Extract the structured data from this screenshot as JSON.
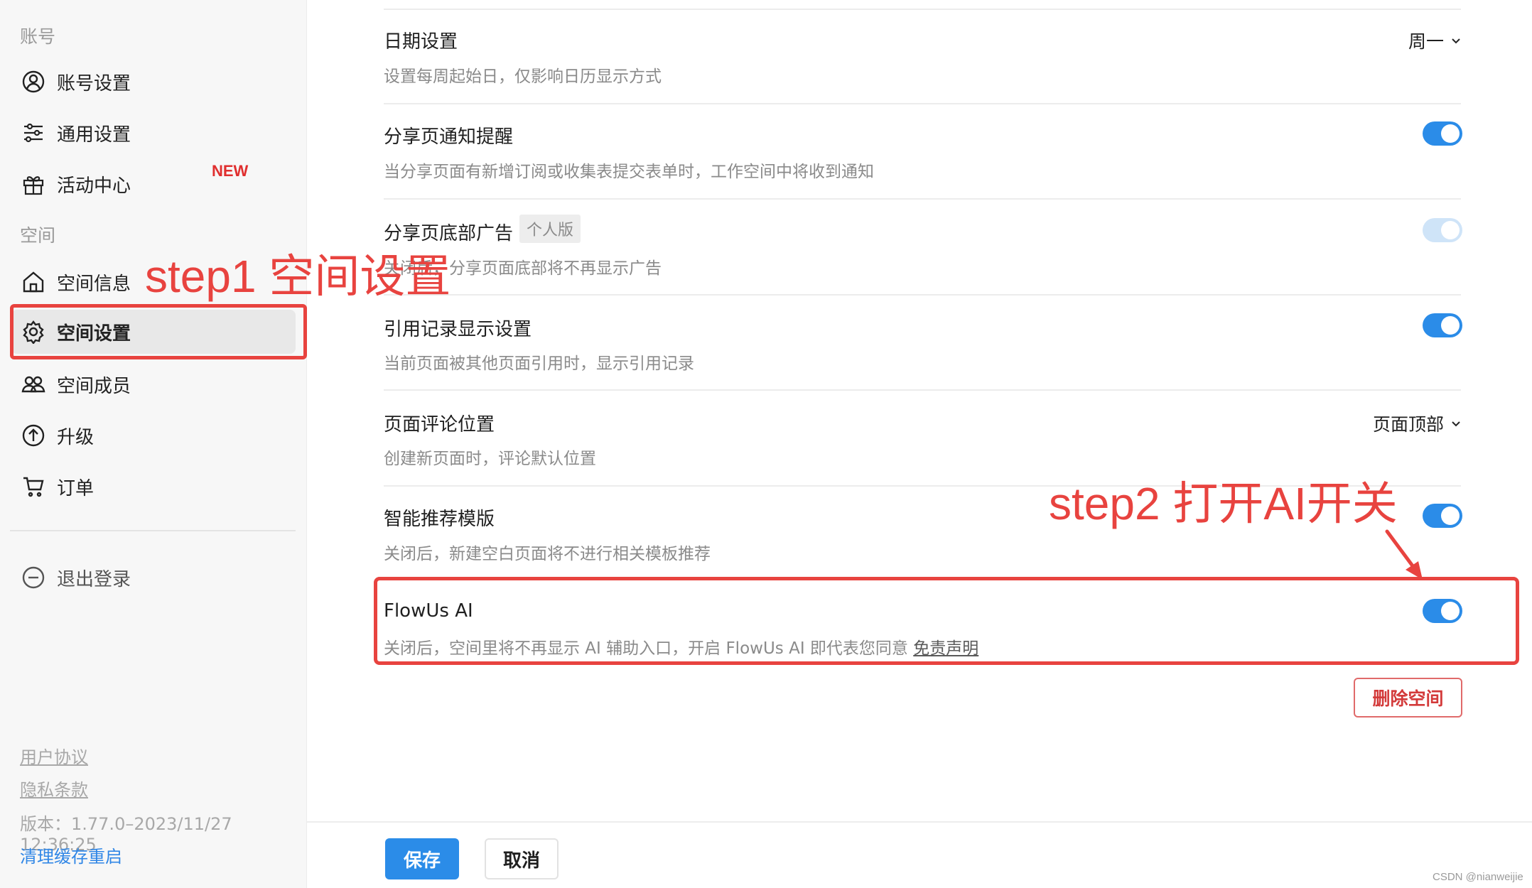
{
  "sidebar": {
    "account_section": "账号",
    "account_items": [
      {
        "label": "账号设置",
        "icon": "user-circle-icon"
      },
      {
        "label": "通用设置",
        "icon": "sliders-icon"
      },
      {
        "label": "活动中心",
        "icon": "gift-icon",
        "badge": "NEW"
      }
    ],
    "space_section": "空间",
    "space_items": [
      {
        "label": "空间信息",
        "icon": "home-icon"
      },
      {
        "label": "空间设置",
        "icon": "gear-icon",
        "active": true
      },
      {
        "label": "空间成员",
        "icon": "members-icon"
      },
      {
        "label": "升级",
        "icon": "arrow-up-circle-icon"
      },
      {
        "label": "订单",
        "icon": "cart-icon"
      }
    ],
    "logout": "退出登录",
    "user_agreement": "用户协议",
    "privacy_policy": "隐私条款",
    "version": "版本：1.77.0–2023/11/27 12:36:25",
    "clear_cache": "清理缓存重启"
  },
  "settings": [
    {
      "title": "日期设置",
      "desc": "设置每周起始日，仅影响日历显示方式",
      "control": "dropdown",
      "value": "周一"
    },
    {
      "title": "分享页通知提醒",
      "desc": "当分享页面有新增订阅或收集表提交表单时，工作空间中将收到通知",
      "control": "toggle",
      "on": true
    },
    {
      "title": "分享页底部广告",
      "badge": "个人版",
      "desc": "关闭后，分享页面底部将不再显示广告",
      "control": "toggle",
      "on": true,
      "disabled": true
    },
    {
      "title": "引用记录显示设置",
      "desc": "当前页面被其他页面引用时，显示引用记录",
      "control": "toggle",
      "on": true
    },
    {
      "title": "页面评论位置",
      "desc": "创建新页面时，评论默认位置",
      "control": "dropdown",
      "value": "页面顶部"
    },
    {
      "title": "智能推荐模版",
      "desc": "关闭后，新建空白页面将不进行相关模板推荐",
      "control": "toggle",
      "on": true
    },
    {
      "title": "FlowUs AI",
      "desc": "关闭后，空间里将不再显示 AI 辅助入口，开启 FlowUs AI 即代表您同意 ",
      "desc_link": "免责声明",
      "control": "toggle",
      "on": true
    }
  ],
  "actions": {
    "delete_space": "删除空间",
    "save": "保存",
    "cancel": "取消"
  },
  "annotations": {
    "step1": "step1 空间设置",
    "step2": "step2 打开AI开关",
    "color": "#e8433f"
  },
  "watermark": "CSDN @nianweijie",
  "colors": {
    "accent": "#2b8ce8",
    "danger": "#d33a3a"
  }
}
